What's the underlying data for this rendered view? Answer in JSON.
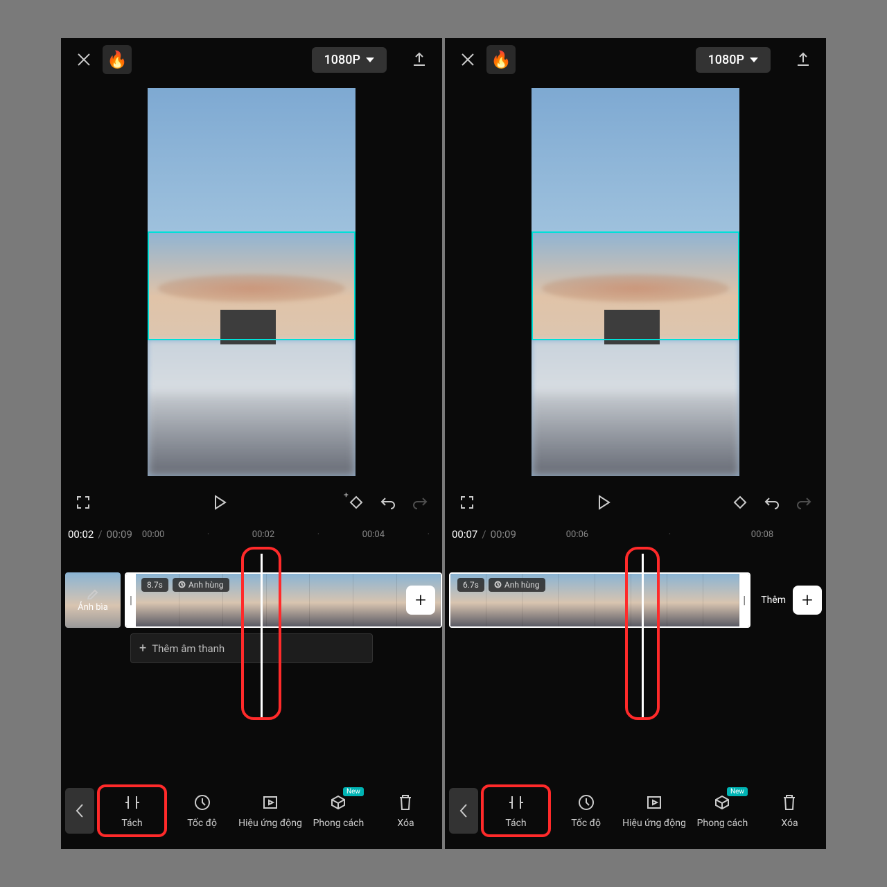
{
  "left": {
    "resolution": "1080P",
    "time_current": "00:02",
    "time_total": "00:09",
    "ruler": [
      "00:00",
      "00:02",
      "00:04"
    ],
    "cover_label": "Ảnh bìa",
    "clip_duration": "8.7s",
    "clip_tag": "Anh hùng",
    "add_audio": "Thêm âm thanh",
    "tools": {
      "split": "Tách",
      "speed": "Tốc độ",
      "animation": "Hiệu ứng động",
      "style": "Phong cách",
      "style_badge": "New",
      "delete": "Xóa"
    }
  },
  "right": {
    "resolution": "1080P",
    "time_current": "00:07",
    "time_total": "00:09",
    "ruler": [
      "00:06",
      "00:08"
    ],
    "clip_duration": "6.7s",
    "clip_tag": "Anh hùng",
    "cover_side": "Thêm",
    "tools": {
      "split": "Tách",
      "speed": "Tốc độ",
      "animation": "Hiệu ứng động",
      "style": "Phong cách",
      "style_badge": "New",
      "delete": "Xóa"
    }
  }
}
